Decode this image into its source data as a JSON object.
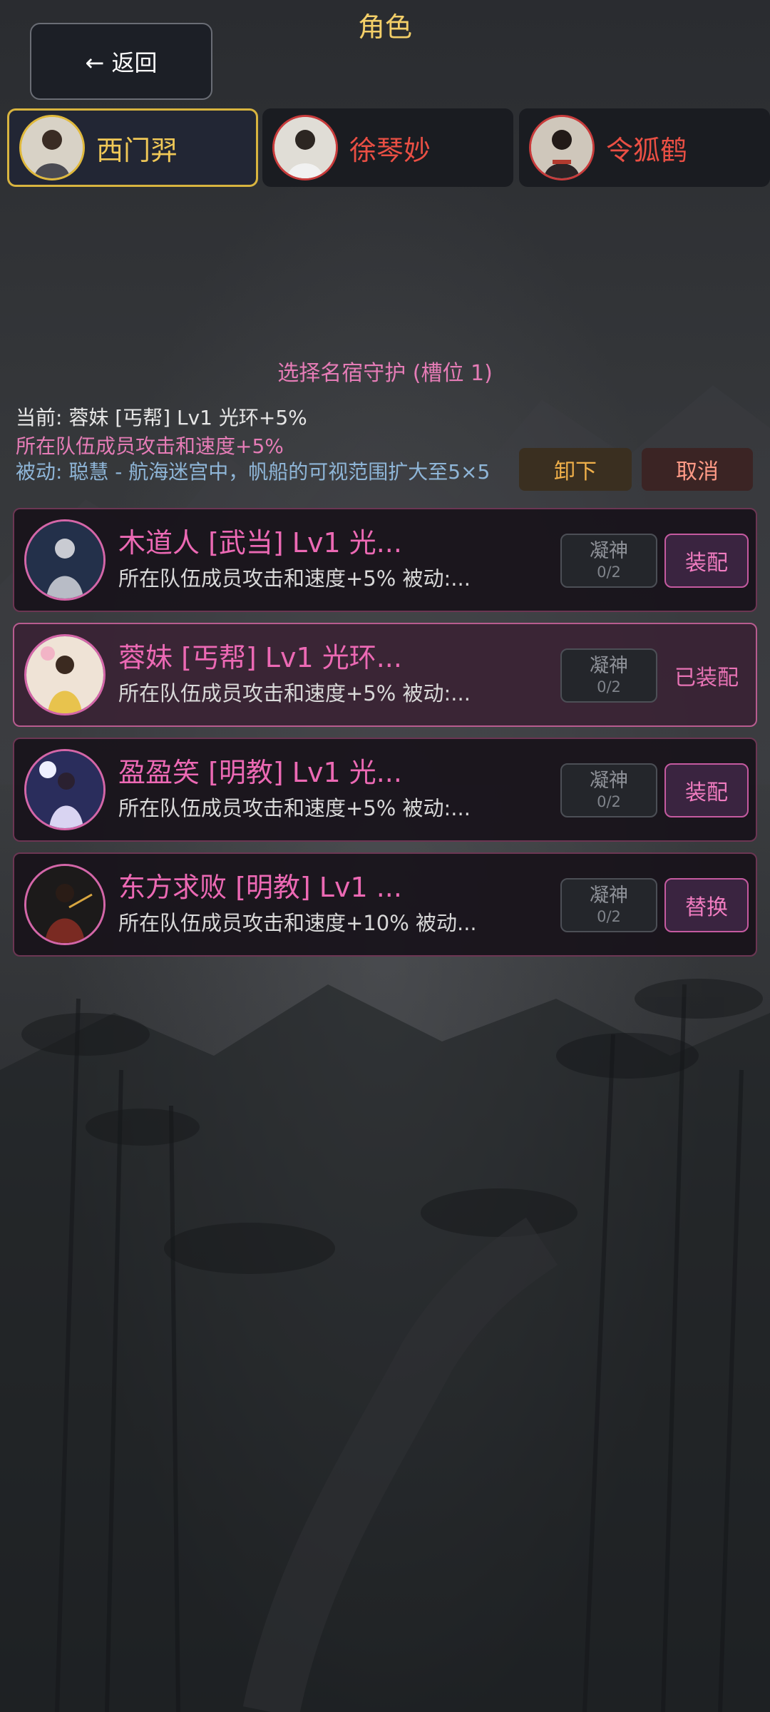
{
  "header": {
    "title": "角色",
    "back_label": "← 返回"
  },
  "heroes": [
    {
      "name": "西门羿",
      "active": true
    },
    {
      "name": "徐琴妙",
      "active": false
    },
    {
      "name": "令狐鹤",
      "active": false
    }
  ],
  "panel": {
    "title": "选择名宿守护 (槽位 1)",
    "current": "当前: 蓉妹 [丐帮] Lv1 光环+5%",
    "aura": "所在队伍成员攻击和速度+5%",
    "passive": "被动: 聪慧 - 航海迷宫中，帆船的可视范围扩大至5×5",
    "unequip_label": "卸下",
    "cancel_label": "取消"
  },
  "cards": [
    {
      "name": "木道人 [武当] Lv1 光...",
      "desc": "所在队伍成员攻击和速度+5% 被动:...",
      "ning_label": "凝神",
      "ning_count": "0/2",
      "action": "装配",
      "equipped": false
    },
    {
      "name": "蓉妹 [丐帮] Lv1 光环...",
      "desc": "所在队伍成员攻击和速度+5% 被动:...",
      "ning_label": "凝神",
      "ning_count": "0/2",
      "action": "已装配",
      "equipped": true
    },
    {
      "name": "盈盈笑 [明教] Lv1 光...",
      "desc": "所在队伍成员攻击和速度+5% 被动:...",
      "ning_label": "凝神",
      "ning_count": "0/2",
      "action": "装配",
      "equipped": false
    },
    {
      "name": "东方求败 [明教] Lv1 ...",
      "desc": "所在队伍成员攻击和速度+10% 被动...",
      "ning_label": "凝神",
      "ning_count": "0/2",
      "action": "替换",
      "equipped": false
    }
  ],
  "colors": {
    "gold_accent": "#f3cf68",
    "pink_accent": "#ec69b4",
    "hero_name_red": "#ea4f44",
    "passive_blue": "#8fb6d8"
  }
}
